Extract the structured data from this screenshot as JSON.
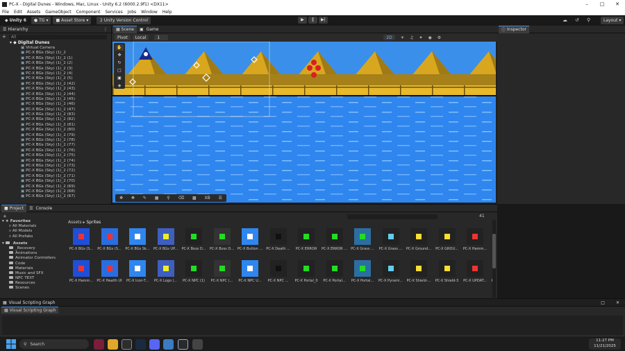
{
  "window": {
    "title": "PC-X - Digital Dunes - Windows, Mac, Linux - Unity 6.2 (6000.2.9f1) <DX11>"
  },
  "menu": [
    "File",
    "Edit",
    "Assets",
    "GameObject",
    "Component",
    "Services",
    "Jobs",
    "Window",
    "Help"
  ],
  "toolbar": {
    "account": "Unity 6",
    "user": "TG",
    "asset_store": "Asset Store",
    "version_control": "Unity Version Control",
    "layout": "Layout",
    "play_icon": "▶",
    "pause_icon": "‖",
    "step_icon": "▶|"
  },
  "hierarchy": {
    "tab": "Hierarchy",
    "search_placeholder": "All",
    "scene": "Digital Dunes",
    "items": [
      "Virtual Camera",
      "PC-X BGs (Sky) (1)_2",
      "PC-X BGs (Sky) (1)_2 (1)",
      "PC-X BGs (Sky) (1)_2 (2)",
      "PC-X BGs (Sky) (1)_2 (3)",
      "PC-X BGs (Sky) (1)_2 (4)",
      "PC-X BGs (Sky) (1)_2 (5)",
      "PC-X BGs (Sky) (1)_2 (42)",
      "PC-X BGs (Sky) (1)_2 (43)",
      "PC-X BGs (Sky) (1)_2 (44)",
      "PC-X BGs (Sky) (1)_2 (45)",
      "PC-X BGs (Sky) (1)_2 (46)",
      "PC-X BGs (Sky) (1)_2 (47)",
      "PC-X BGs (Sky) (1)_2 (83)",
      "PC-X BGs (Sky) (1)_2 (82)",
      "PC-X BGs (Sky) (1)_2 (81)",
      "PC-X BGs (Sky) (1)_2 (80)",
      "PC-X BGs (Sky) (1)_2 (79)",
      "PC-X BGs (Sky) (1)_2 (78)",
      "PC-X BGs (Sky) (1)_2 (77)",
      "PC-X BGs (Sky) (1)_2 (76)",
      "PC-X BGs (Sky) (1)_2 (75)",
      "PC-X BGs (Sky) (1)_2 (74)",
      "PC-X BGs (Sky) (1)_2 (73)",
      "PC-X BGs (Sky) (1)_2 (72)",
      "PC-X BGs (Sky) (1)_2 (71)",
      "PC-X BGs (Sky) (1)_2 (70)",
      "PC-X BGs (Sky) (1)_2 (69)",
      "PC-X BGs (Sky) (1)_2 (68)",
      "PC-X BGs (Sky) (1)_2 (67)"
    ]
  },
  "scene": {
    "tabs": [
      "Scene",
      "Game"
    ],
    "pivot": "Pivot",
    "local": "Local",
    "grid_value": "1",
    "mode_2d": "2D",
    "xb_button": "XB"
  },
  "inspector": {
    "tab": "Inspector"
  },
  "project": {
    "tabs": [
      "Project",
      "Console"
    ],
    "favorites": {
      "label": "Favorites",
      "items": [
        "All Materials",
        "All Models",
        "All Prefabs"
      ]
    },
    "assets_root": "Assets",
    "folders": [
      "_Recovery",
      "Animations",
      "Animator Controllers",
      "Code",
      "Materials",
      "Music and SFX",
      "NPC TEXT",
      "Resources",
      "Scenes"
    ],
    "breadcrumb": [
      "Assets",
      "Sprites"
    ],
    "count": "41",
    "row1": [
      "PC-X BGs (S...",
      "PC-X BGs (S...",
      "PC-X BGs Sk...",
      "PC-X BGs UP...",
      "PC-X Boss D...",
      "PC-X Boss D...",
      "PC-X Button ...",
      "PC-X Death ...",
      "PC-X ERROR",
      "PC-X ERROR ...",
      "PC-X Grass ...",
      "PC-X Grass ...",
      "PC-X Ground...",
      "PC-X GROU...",
      "PC-X Hamm..."
    ],
    "row2": [
      "PC-X Hamm...",
      "PC-X Health UI",
      "PC-X Icon-T...",
      "PC-X Logo (...",
      "PC-X NPC (1)",
      "PC-X NPC (...",
      "PC-X NPC U...",
      "PC-X NPC ...",
      "PC-X Portal_0",
      "PC-X Portal...",
      "PC-X Portal...",
      "PC-X Pyrami...",
      "PC-X Shield-...",
      "PC-X Shield-3",
      "PC-X UPDAT...",
      "PC-X UPDAT..."
    ]
  },
  "visual_scripting": {
    "title": "Visual Scripting Graph",
    "tab": "Visual Scripting Graph"
  },
  "taskbar": {
    "search_placeholder": "Search",
    "time": "11:27 PM",
    "date": "11/21/2025"
  },
  "colors": {
    "sky": "#2f86ee",
    "sand": "#e7b92b",
    "accent": "#4a90e2"
  }
}
